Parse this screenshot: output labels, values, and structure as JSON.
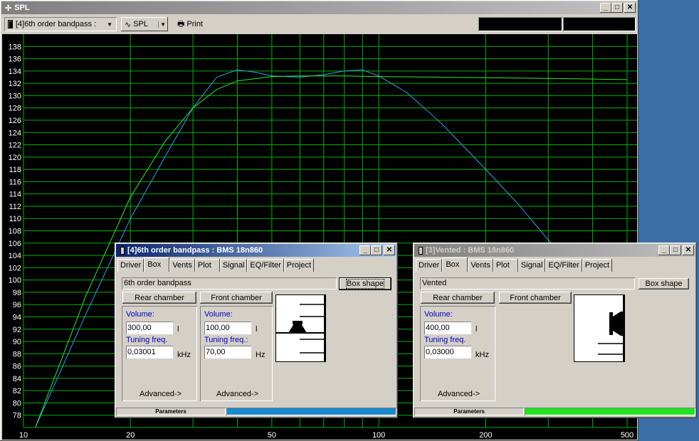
{
  "main_window": {
    "title": "SPL",
    "toolbar": {
      "box_select": "[4]6th order bandpass :",
      "view_select": "SPL",
      "print": "Print"
    }
  },
  "chart_data": {
    "type": "line",
    "x_scale": "log",
    "xlim": [
      10,
      500
    ],
    "ylim": [
      76,
      140
    ],
    "x_ticks": [
      "10",
      "20",
      "50",
      "100",
      "200",
      "500"
    ],
    "y_ticks": [
      "78",
      "80",
      "82",
      "84",
      "86",
      "88",
      "90",
      "92",
      "94",
      "96",
      "98",
      "100",
      "102",
      "104",
      "106",
      "108",
      "110",
      "112",
      "114",
      "116",
      "118",
      "120",
      "122",
      "124",
      "126",
      "128",
      "130",
      "132",
      "134",
      "136",
      "138"
    ],
    "grid": true,
    "series": [
      {
        "color": "#2aa6e6",
        "x": [
          10.8,
          15,
          20,
          25,
          30,
          35,
          40,
          45,
          50,
          60,
          70,
          80,
          90,
          100,
          120,
          150,
          200,
          250,
          300,
          350
        ],
        "y": [
          76,
          94.5,
          110,
          120,
          128,
          133,
          134.2,
          133.8,
          133.2,
          133,
          133.4,
          134,
          134.2,
          133.2,
          130.5,
          125.5,
          118,
          112,
          106.5,
          102.5
        ]
      },
      {
        "color": "#33e633",
        "x": [
          10.8,
          15,
          20,
          25,
          30,
          35,
          40,
          50,
          60,
          80,
          100,
          150,
          200,
          300,
          500
        ],
        "y": [
          76,
          97.5,
          113.5,
          122.5,
          128,
          131,
          132.4,
          133.1,
          133.2,
          133.2,
          133.1,
          133,
          132.9,
          132.8,
          132.6
        ]
      }
    ]
  },
  "dialog_bp": {
    "title": "[4]6th order bandpass : BMS 18n860",
    "tabs": [
      "Driver",
      "Box",
      "Vents",
      "Plot",
      "Signal",
      "EQ/Filter",
      "Project"
    ],
    "box_type": "6th order bandpass",
    "box_shape_button": "Box shape",
    "rear_chamber_label": "Rear chamber",
    "front_chamber_label": "Front chamber",
    "rear": {
      "volume_label": "Volume:",
      "volume_value": "300,00",
      "volume_unit": "l",
      "tuning_label": "Tuning freq.",
      "tuning_value": "0,03001",
      "tuning_unit": "kHz"
    },
    "front": {
      "volume_label": "Volume:",
      "volume_value": "100,00",
      "volume_unit": "l",
      "tuning_label": "Tuning freq.:",
      "tuning_value": "70,00",
      "tuning_unit": "Hz"
    },
    "advanced_label": "Advanced->",
    "status_label": "Parameters",
    "status_color": "#1c88d0"
  },
  "dialog_vented": {
    "title": "[3]Vented : BMS 18n860",
    "tabs": [
      "Driver",
      "Box",
      "Vents",
      "Plot",
      "Signal",
      "EQ/Filter",
      "Project"
    ],
    "box_type": "Vented",
    "box_shape_button": "Box shape",
    "rear_chamber_label": "Rear chamber",
    "front_chamber_label": "Front chamber",
    "rear": {
      "volume_label": "Volume:",
      "volume_value": "400,00",
      "volume_unit": "l",
      "tuning_label": "Tuning freq.",
      "tuning_value": "0,03000",
      "tuning_unit": "kHz"
    },
    "advanced_label": "Advanced->",
    "status_label": "Parameters",
    "status_color": "#1ee61e"
  }
}
